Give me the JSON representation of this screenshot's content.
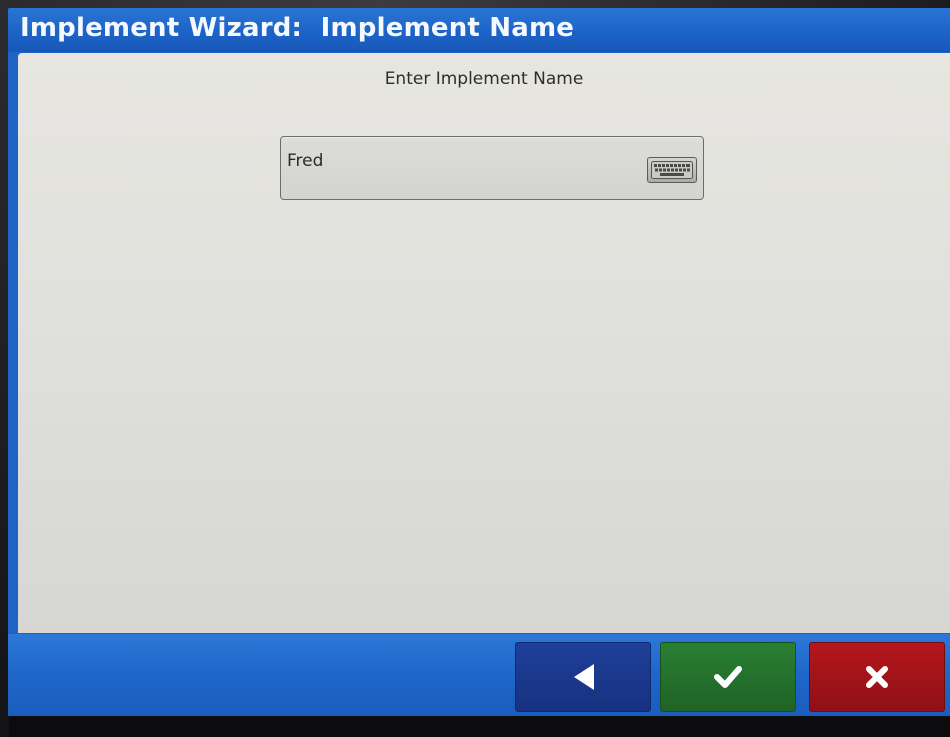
{
  "window": {
    "title": "Implement Wizard:  Implement Name"
  },
  "form": {
    "prompt": "Enter Implement Name",
    "name_field": {
      "value": "Fred",
      "keyboard_icon": "keyboard-icon"
    }
  },
  "footer": {
    "back_icon": "back-arrow-icon",
    "confirm_icon": "checkmark-icon",
    "cancel_icon": "close-icon"
  },
  "colors": {
    "title_bar": "#1f63c6",
    "content_bg": "#e0e0dc",
    "back_button": "#1a3a8e",
    "confirm_button": "#247030",
    "cancel_button": "#a3141a"
  }
}
